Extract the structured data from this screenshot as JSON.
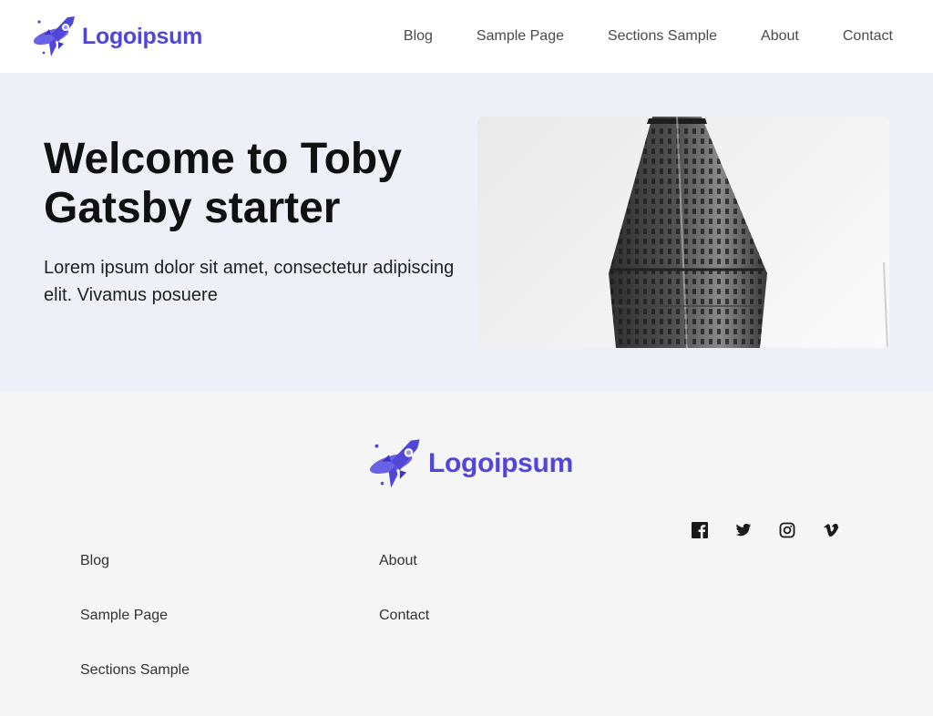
{
  "brand": {
    "name": "Logoipsum",
    "color": "#5146d8",
    "icon": "rocket-logo-icon"
  },
  "nav": {
    "items": [
      {
        "label": "Blog"
      },
      {
        "label": "Sample Page"
      },
      {
        "label": "Sections Sample"
      },
      {
        "label": "About"
      },
      {
        "label": "Contact"
      }
    ]
  },
  "hero": {
    "title": "Welcome to Toby Gatsby starter",
    "text": "Lorem ipsum dolor sit amet, consectetur adipiscing elit. Vivamus posuere",
    "image": "flatiron-building-photo",
    "background": "#efeff8"
  },
  "footer": {
    "columns": [
      [
        {
          "label": "Blog"
        },
        {
          "label": "Sample Page"
        },
        {
          "label": "Sections Sample"
        }
      ],
      [
        {
          "label": "About"
        },
        {
          "label": "Contact"
        }
      ]
    ],
    "social": [
      "facebook-icon",
      "twitter-icon",
      "instagram-icon",
      "vimeo-icon"
    ]
  }
}
